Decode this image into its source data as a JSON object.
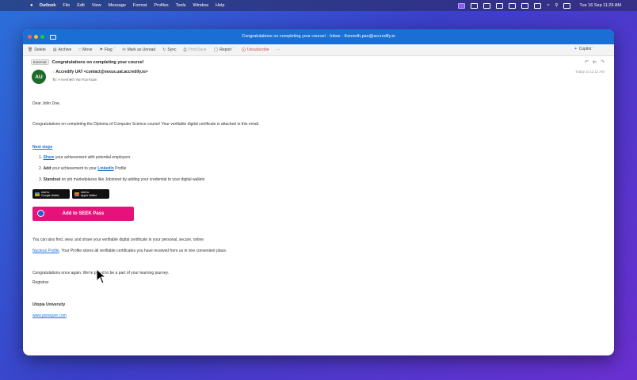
{
  "menubar": {
    "items": [
      "Outlook",
      "File",
      "Edit",
      "View",
      "Message",
      "Format",
      "Profiles",
      "Tools",
      "Window",
      "Help"
    ],
    "clock": "Tue 16 Sep  11:25 AM"
  },
  "window": {
    "title": "Congratulations on completing your course! - Inbox - Kenneth.pan@accredify.io"
  },
  "toolbar": {
    "delete": "Delete",
    "archive": "Archive",
    "move": "Move",
    "flag": "Flag",
    "mark_unread": "Mark as Unread",
    "sync": "Sync",
    "print": "Print/Save",
    "report": "Report",
    "unsubscribe": "Unsubscribe",
    "copilot": "Copilot"
  },
  "message": {
    "external_badge": "External",
    "subject": "Congratulations on completing your course!",
    "avatar_initials": "AU",
    "sender": "Accredify UAT <contact@nexus.uat.accredify.io>",
    "to_label": "To:",
    "recipient": "Kenneth Yan Kai Kuan",
    "date": "Today at 11:12 AM"
  },
  "body": {
    "greeting": "Dear John Doe,",
    "intro": "Congratulations on completing the Diploma of Computer Science course! Your verifiable digital certificate is attached in this email.",
    "next_steps_heading": "Next steps",
    "steps": [
      {
        "num": "1.",
        "link": "Share",
        "rest": " your achievement with potential employers"
      },
      {
        "num": "2.",
        "bold": "Add",
        "middle": " your achievement to your ",
        "link": "LinkedIn",
        "rest": " Profile"
      },
      {
        "num": "3.",
        "bold": "Standout",
        "rest": " on job marketplaces like Jobstreet by adding your credential to your digital wallets"
      }
    ],
    "google_wallet": {
      "line1": "Add to",
      "line2": "Google Wallet"
    },
    "apple_wallet": {
      "line1": "Add to",
      "line2": "Apple Wallet"
    },
    "seek_button": "Add to SEEK Pass",
    "profile_line1": "You can also find, view, and share your verifiable digital certificate in your personal, secure, online",
    "profile_link": "Nucleus Profile",
    "profile_line2": ". Your Profile stores all verifiable certificates you have received from us in one convenient place.",
    "closing": "Congratulations once again. We're proud to be a part of your learning journey.",
    "signoff": "Registrar",
    "org": "Utopia University",
    "website": "www.pixisqure.com"
  },
  "colors": {
    "titlebar": "#1a6fd4",
    "seek": "#e6117a",
    "avatar": "#1d6b2a",
    "link": "#1a6fd4"
  }
}
